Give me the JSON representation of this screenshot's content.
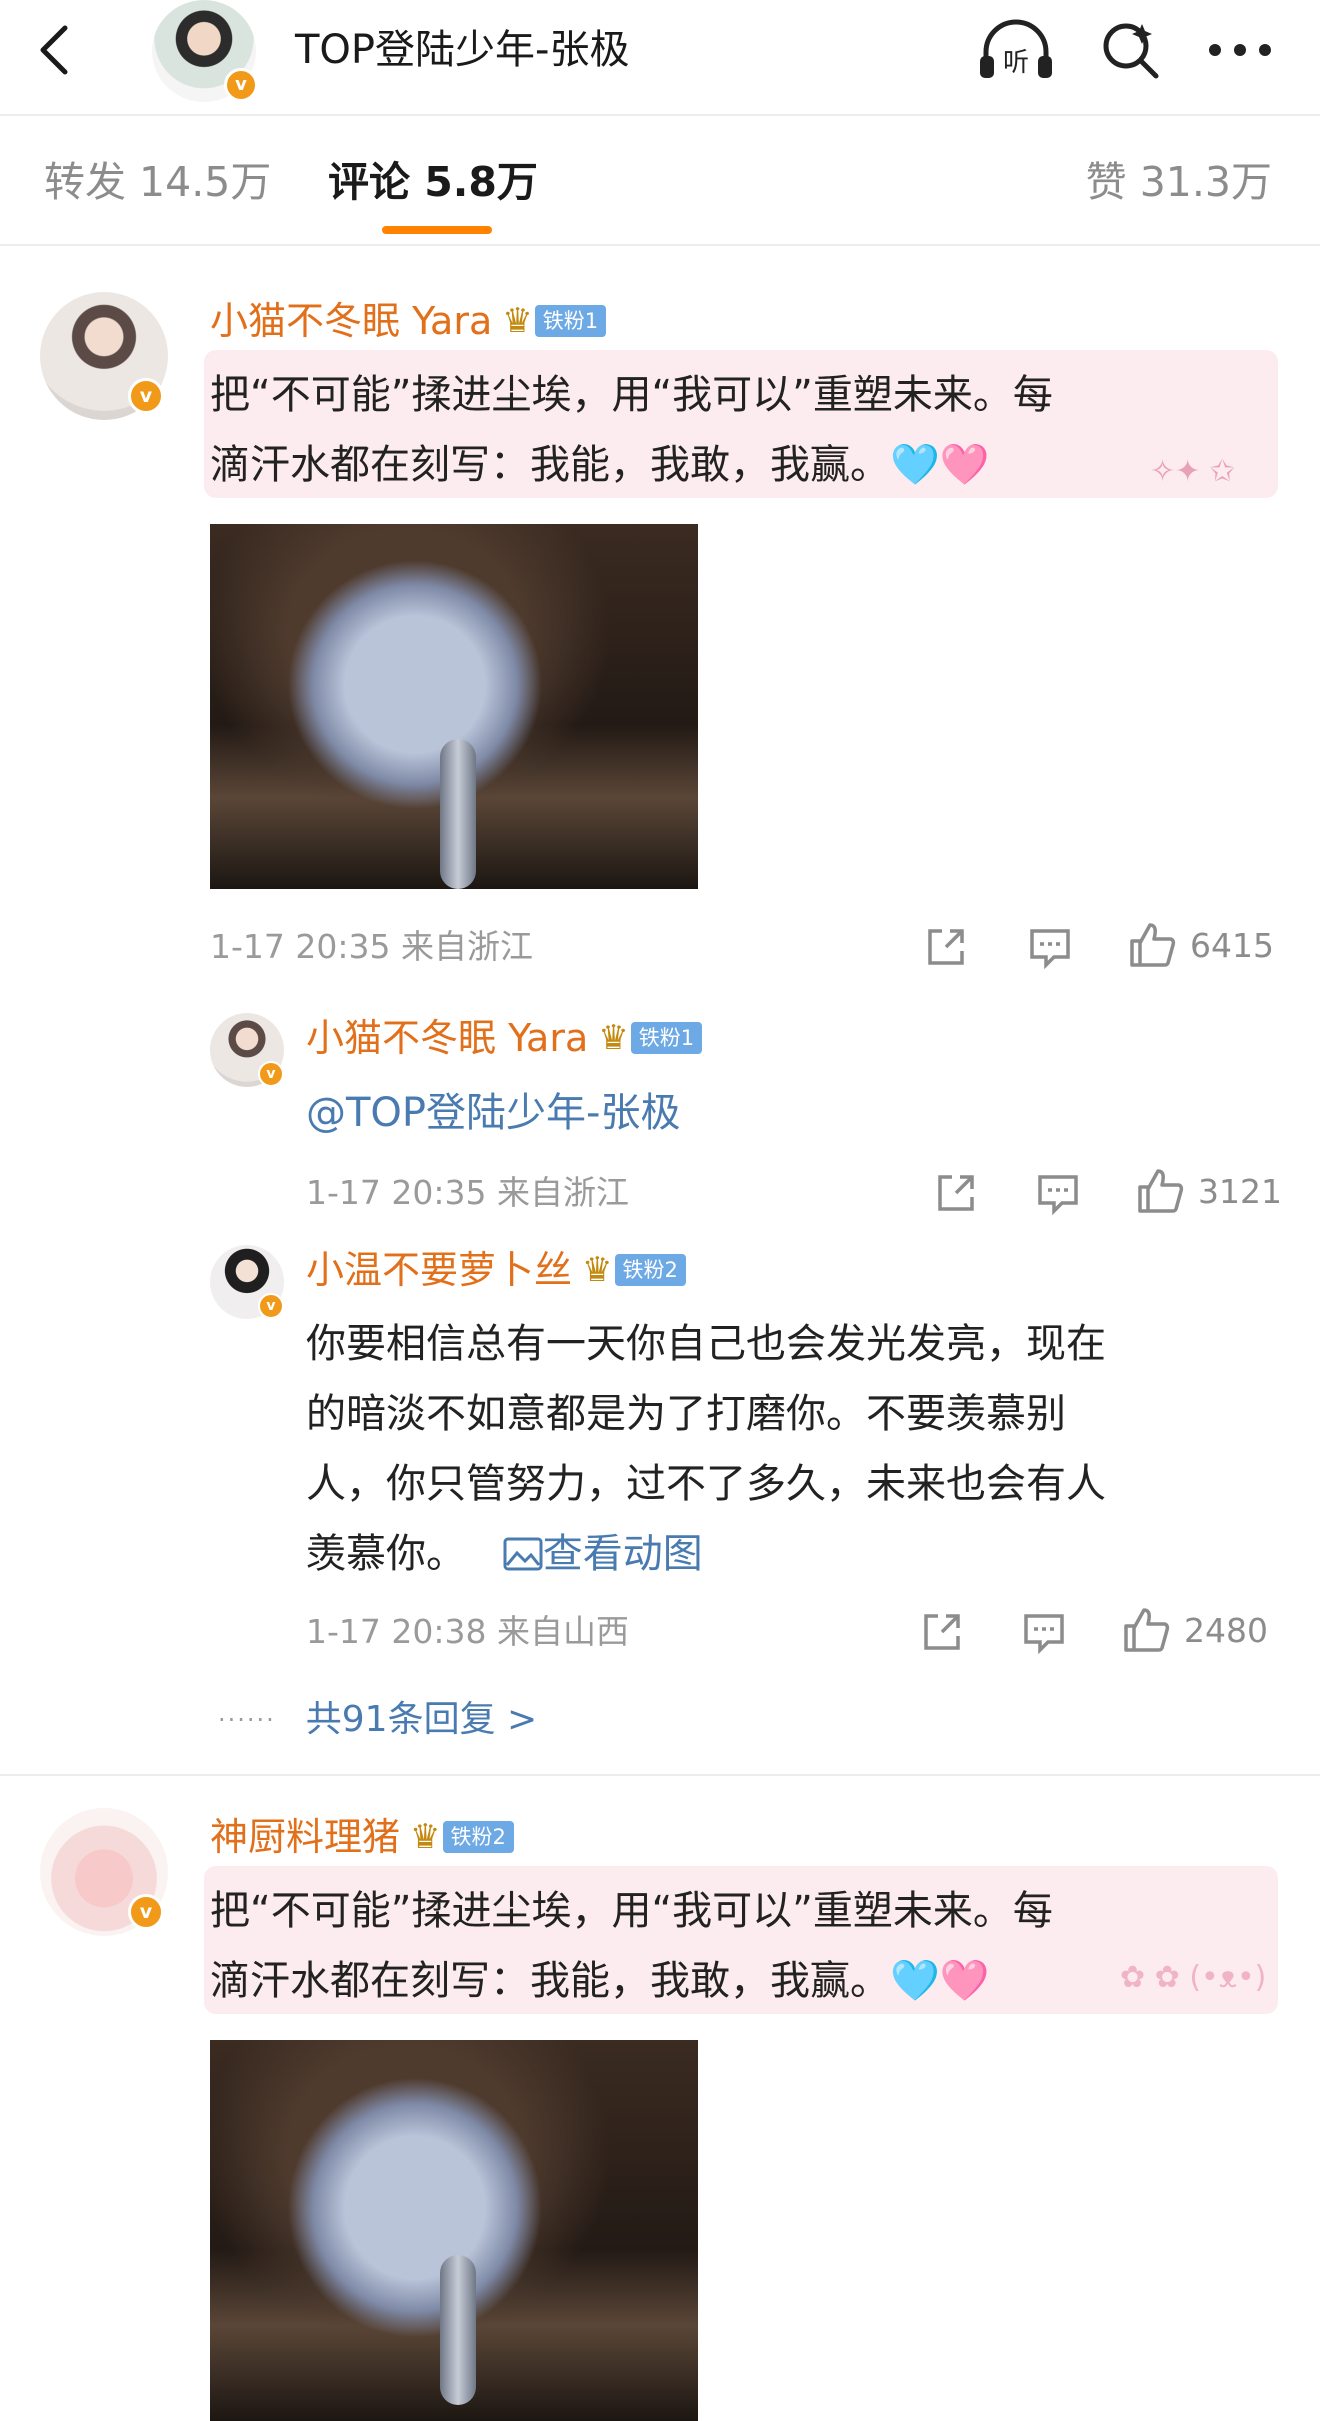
{
  "header": {
    "title": "TOP登陆少年-张极",
    "verified_mark": "v",
    "listen_label": "听"
  },
  "tabs": {
    "repost": "转发 14.5万",
    "comment": "评论 5.8万",
    "like": "赞 31.3万"
  },
  "colors": {
    "accent": "#ff8200",
    "username": "#e2701b",
    "link": "#4a7bb0",
    "bubble": "#fcebef",
    "fan_badge": "#6da9e4"
  },
  "comments": [
    {
      "username": "小猫不冬眠 Yara",
      "fan_badge": "铁粉1",
      "text_line1": "把“不可能”揉进尘埃，用“我可以”重塑未来。每",
      "text_line2": "滴汗水都在刻写：我能，我敢，我赢。",
      "emoji": "🩵🩷",
      "time_location": "1-17 20:35 来自浙江",
      "likes": "6415",
      "replies": [
        {
          "username": "小猫不冬眠 Yara",
          "fan_badge": "铁粉1",
          "mention": "@TOP登陆少年-张极",
          "time_location": "1-17 20:35 来自浙江",
          "likes": "3121"
        },
        {
          "username": "小温不要萝卜丝",
          "fan_badge": "铁粉2",
          "text_lines": [
            "你要相信总有一天你自己也会发光发亮，现在",
            "的暗淡不如意都是为了打磨你。不要羡慕别",
            "人，你只管努力，过不了多久，未来也会有人",
            "羡慕你。"
          ],
          "gif_link": "查看动图",
          "time_location": "1-17 20:38 来自山西",
          "likes": "2480"
        }
      ],
      "more_replies": "共91条回复 >"
    },
    {
      "username": "神厨料理猪",
      "fan_badge": "铁粉2",
      "text_line1": "把“不可能”揉进尘埃，用“我可以”重塑未来。每",
      "text_line2": "滴汗水都在刻写：我能，我敢，我赢。",
      "emoji": "🩵🩷"
    }
  ]
}
